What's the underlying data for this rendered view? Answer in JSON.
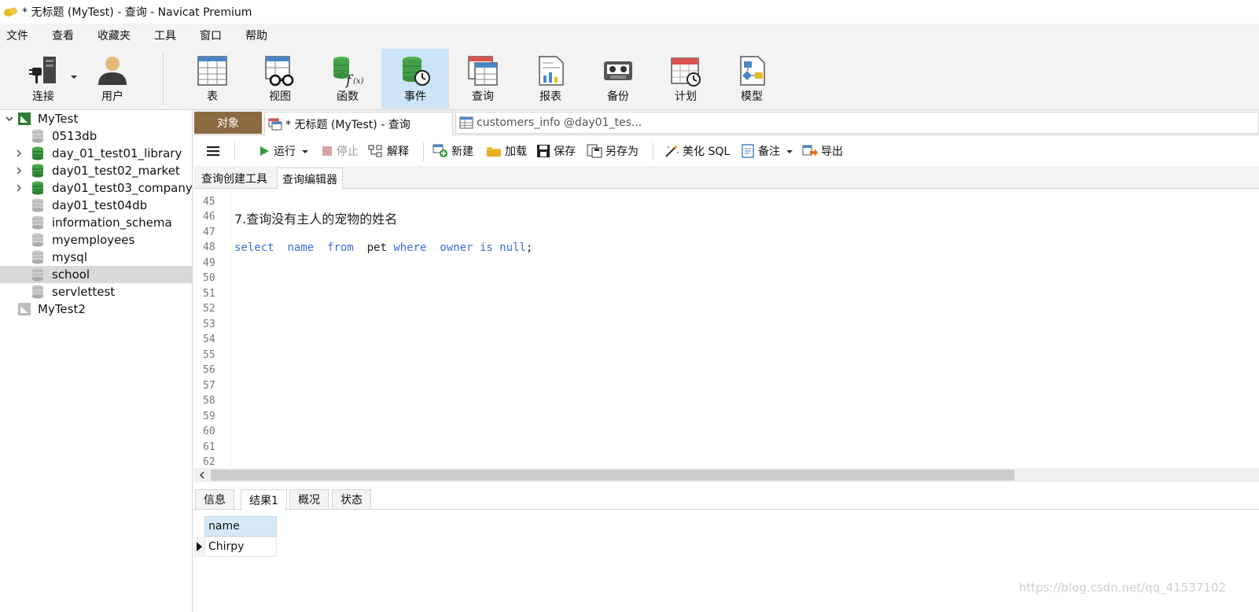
{
  "window": {
    "title": "* 无标题 (MyTest) - 查询 - Navicat Premium"
  },
  "menu": [
    "文件",
    "查看",
    "收藏夹",
    "工具",
    "窗口",
    "帮助"
  ],
  "ribbon": {
    "connect": "连接",
    "user": "用户",
    "table": "表",
    "view": "视图",
    "function": "函数",
    "event": "事件",
    "query": "查询",
    "report": "报表",
    "backup": "备份",
    "schedule": "计划",
    "model": "模型"
  },
  "sidebar": {
    "connections": [
      {
        "label": "MyTest"
      },
      {
        "label": "MyTest2"
      }
    ],
    "databases": [
      "0513db",
      "day_01_test01_library",
      "day01_test02_market",
      "day01_test03_company",
      "day01_test04db",
      "information_schema",
      "myemployees",
      "mysql",
      "school",
      "servlettest"
    ],
    "selected": "school"
  },
  "tabs": {
    "objects": "对象",
    "query": "* 无标题 (MyTest) - 查询",
    "table": "customers_info @day01_tes..."
  },
  "toolbar": {
    "run": "运行",
    "stop": "停止",
    "explain": "解释",
    "new": "新建",
    "load": "加载",
    "save": "保存",
    "save_as": "另存为",
    "beautify": "美化 SQL",
    "comment": "备注",
    "export": "导出"
  },
  "subtabs": {
    "builder": "查询创建工具",
    "editor": "查询编辑器"
  },
  "editor": {
    "line_numbers": [
      "45",
      "46",
      "47",
      "48",
      "49",
      "50",
      "51",
      "52",
      "53",
      "54",
      "55",
      "56",
      "57",
      "58",
      "59",
      "60",
      "61",
      "62"
    ],
    "comment_text": "7.查询没有主人的宠物的姓名",
    "sql": {
      "select": "select",
      "name": "name",
      "from": "from",
      "pet": "pet",
      "where": "where",
      "owner": "owner",
      "is": "is",
      "null": "null",
      "end": ";"
    }
  },
  "result_tabs": [
    "信息",
    "结果1",
    "概况",
    "状态"
  ],
  "result": {
    "column": "name",
    "rows": [
      "Chirpy"
    ]
  },
  "watermark": "https://blog.csdn.net/qq_41537102"
}
